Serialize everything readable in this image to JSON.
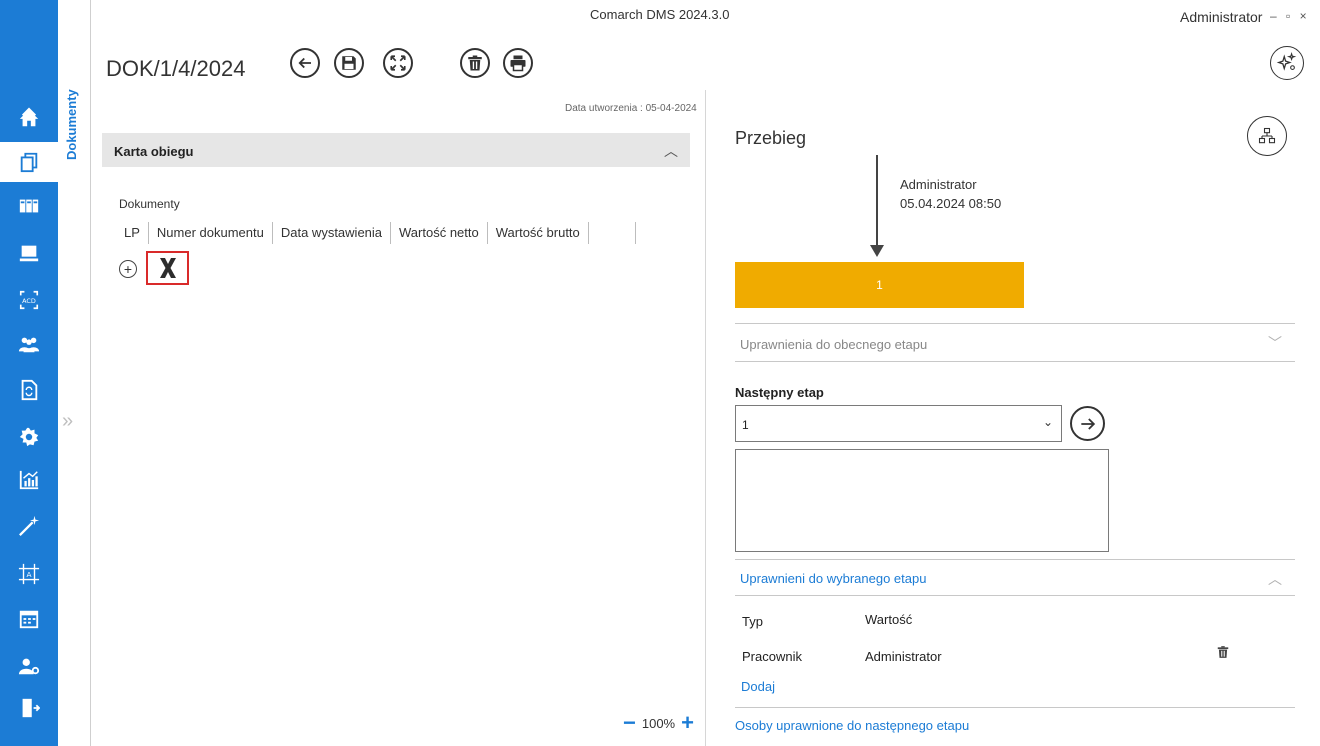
{
  "app": {
    "title": "Comarch DMS 2024.3.0",
    "user": "Administrator",
    "window_controls": "– ▫ ×"
  },
  "nav": {
    "accent": "#1c7cd5",
    "items": [
      "home-icon",
      "documents-icon",
      "dashboard-icon",
      "workstation-icon",
      "ocr-icon",
      "users-icon",
      "workflow-doc-icon",
      "settings-icon",
      "reports-icon",
      "wizard-icon",
      "layout-icon",
      "calendar-icon",
      "user-settings-icon",
      "logout-icon"
    ],
    "active": "documents-icon"
  },
  "doc_tab": {
    "label": "Dokumenty"
  },
  "document": {
    "number": "DOK/1/4/2024",
    "created": "Data utworzenia : 05-04-2024"
  },
  "card": {
    "title": "Karta obiegu",
    "section_label": "Dokumenty",
    "columns": [
      "LP",
      "Numer dokumentu",
      "Data wystawienia",
      "Wartość netto",
      "Wartość brutto",
      ""
    ]
  },
  "zoom": {
    "value": "100%",
    "minus": "−",
    "plus": "+"
  },
  "workflow": {
    "title": "Przebieg",
    "step_user": "Administrator",
    "step_date": "05.04.2024 08:50",
    "step_label": "1",
    "step_color": "#f0ab00",
    "current_permissions": "Uprawnienia do obecnego etapu",
    "next_stage_label": "Następny etap",
    "next_stage_value": "1",
    "selected_permissions": "Uprawnieni do wybranego etapu",
    "table": {
      "type_header": "Typ",
      "value_header": "Wartość",
      "rows": [
        {
          "type": "Pracownik",
          "value": "Administrator"
        }
      ]
    },
    "add_label": "Dodaj",
    "next_people": "Osoby uprawnione do następnego etapu"
  }
}
